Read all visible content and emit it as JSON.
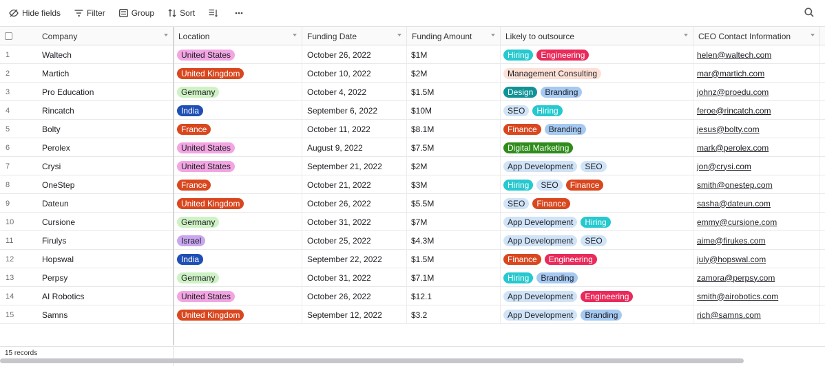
{
  "toolbar": {
    "hide_fields": "Hide fields",
    "filter": "Filter",
    "group": "Group",
    "sort": "Sort"
  },
  "columns": [
    {
      "label": "Company"
    },
    {
      "label": "Location"
    },
    {
      "label": "Funding Date"
    },
    {
      "label": "Funding Amount"
    },
    {
      "label": "Likely to outsource"
    },
    {
      "label": "CEO Contact Information"
    }
  ],
  "tag_colors": {
    "United States": "#f2a5e2",
    "United Kingdom": "#d9471f",
    "Germany": "#cff2c5",
    "India": "#1f4fb4",
    "France": "#d9471f",
    "Israel": "#c9a7ef",
    "Hiring": "#25c9cf",
    "Engineering": "#e92a5a",
    "Management Consulting": "#fde0d6",
    "Design": "#119396",
    "Branding": "#a6c9f2",
    "SEO": "#d0e3f7",
    "Finance": "#d9471f",
    "Digital Marketing": "#2f8c1a",
    "App Development": "#d0e3f7"
  },
  "rows": [
    {
      "num": "1",
      "company": "Waltech",
      "location": "United States",
      "date": "October 26, 2022",
      "amount": "$1M",
      "tags": [
        "Hiring",
        "Engineering"
      ],
      "email": "helen@waltech.com"
    },
    {
      "num": "2",
      "company": "Martich",
      "location": "United Kingdom",
      "date": "October 10, 2022",
      "amount": "$2M",
      "tags": [
        "Management Consulting"
      ],
      "email": "mar@martich.com"
    },
    {
      "num": "3",
      "company": "Pro Education",
      "location": "Germany",
      "date": "October 4, 2022",
      "amount": "$1.5M",
      "tags": [
        "Design",
        "Branding"
      ],
      "email": "johnz@proedu.com"
    },
    {
      "num": "4",
      "company": "Rincatch",
      "location": "India",
      "date": "September 6, 2022",
      "amount": "$10M",
      "tags": [
        "SEO",
        "Hiring"
      ],
      "email": "feroe@rincatch.com"
    },
    {
      "num": "5",
      "company": "Bolty",
      "location": "France",
      "date": "October 11, 2022",
      "amount": "$8.1M",
      "tags": [
        "Finance",
        "Branding"
      ],
      "email": "jesus@bolty.com"
    },
    {
      "num": "6",
      "company": "Perolex",
      "location": "United States",
      "date": "August 9, 2022",
      "amount": "$7.5M",
      "tags": [
        "Digital Marketing"
      ],
      "email": "mark@perolex.com"
    },
    {
      "num": "7",
      "company": "Crysi",
      "location": "United States",
      "date": "September 21, 2022",
      "amount": "$2M",
      "tags": [
        "App Development",
        "SEO"
      ],
      "email": "jon@crysi.com"
    },
    {
      "num": "8",
      "company": "OneStep",
      "location": "France",
      "date": "October 21, 2022",
      "amount": "$3M",
      "tags": [
        "Hiring",
        "SEO",
        "Finance"
      ],
      "email": "smith@onestep.com"
    },
    {
      "num": "9",
      "company": "Dateun",
      "location": "United Kingdom",
      "date": "October 26, 2022",
      "amount": "$5.5M",
      "tags": [
        "SEO",
        "Finance"
      ],
      "email": "sasha@dateun.com"
    },
    {
      "num": "10",
      "company": "Cursione",
      "location": "Germany",
      "date": "October 31, 2022",
      "amount": "$7M",
      "tags": [
        "App Development",
        "Hiring"
      ],
      "email": "emmy@cursione.com"
    },
    {
      "num": "11",
      "company": "Firulys",
      "location": "Israel",
      "date": "October 25, 2022",
      "amount": "$4.3M",
      "tags": [
        "App Development",
        "SEO"
      ],
      "email": "aime@firukes.com"
    },
    {
      "num": "12",
      "company": "Hopswal",
      "location": "India",
      "date": "September 22, 2022",
      "amount": "$1.5M",
      "tags": [
        "Finance",
        "Engineering"
      ],
      "email": "july@hopswal.com"
    },
    {
      "num": "13",
      "company": "Perpsy",
      "location": "Germany",
      "date": "October 31, 2022",
      "amount": "$7.1M",
      "tags": [
        "Hiring",
        "Branding"
      ],
      "email": "zamora@perpsy.com"
    },
    {
      "num": "14",
      "company": "AI Robotics",
      "location": "United States",
      "date": "October 26, 2022",
      "amount": "$12.1",
      "tags": [
        "App Development",
        "Engineering"
      ],
      "email": "smith@airobotics.com"
    },
    {
      "num": "15",
      "company": "Samns",
      "location": "United Kingdom",
      "date": "September 12, 2022",
      "amount": "$3.2",
      "tags": [
        "App Development",
        "Branding"
      ],
      "email": "rich@samns.com"
    }
  ],
  "footer": {
    "records": "15 records"
  }
}
